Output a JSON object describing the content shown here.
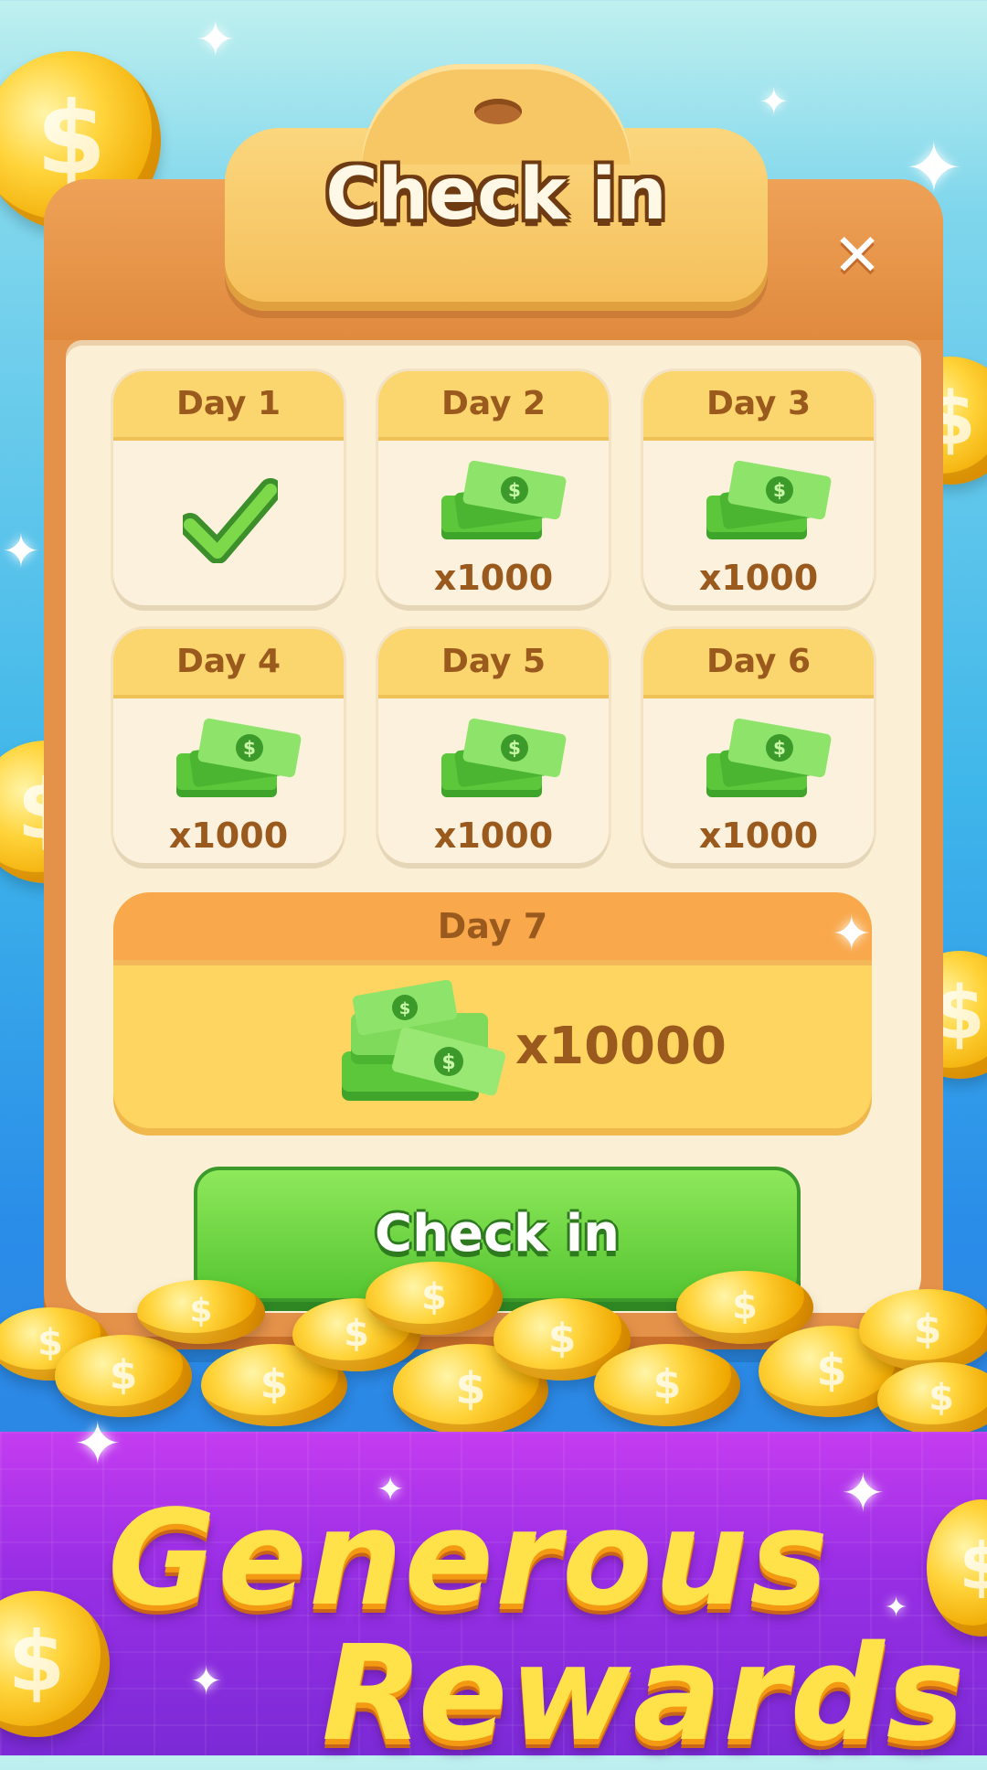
{
  "header": {
    "title": "Check in",
    "close_label": "✕"
  },
  "days": [
    {
      "label": "Day 1",
      "amount": "",
      "claimed": true
    },
    {
      "label": "Day 2",
      "amount": "x1000",
      "claimed": false
    },
    {
      "label": "Day 3",
      "amount": "x1000",
      "claimed": false
    },
    {
      "label": "Day 4",
      "amount": "x1000",
      "claimed": false
    },
    {
      "label": "Day 5",
      "amount": "x1000",
      "claimed": false
    },
    {
      "label": "Day 6",
      "amount": "x1000",
      "claimed": false
    }
  ],
  "day7": {
    "label": "Day 7",
    "amount": "x10000"
  },
  "actions": {
    "checkin_label": "Check in"
  },
  "promo": {
    "line1": "Generous",
    "line2": "Rewards"
  },
  "colors": {
    "accent_green": "#56c531",
    "board_orange": "#e4914a",
    "banner_purple": "#9b2fe6",
    "gold": "#ffd43b"
  }
}
